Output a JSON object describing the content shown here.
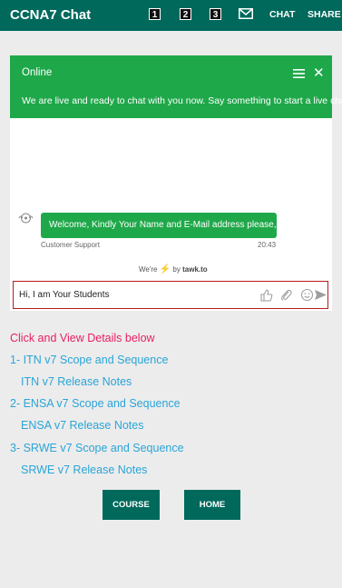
{
  "topbar": {
    "title": "CCNA7 Chat",
    "nums": [
      "1",
      "2",
      "3"
    ],
    "chat_label": "CHAT",
    "share_label": "SHARE"
  },
  "chat": {
    "status": "Online",
    "intro": "We are live and ready to chat with you now. Say something to start a live chat.",
    "message": "Welcome, Kindly Your Name and E-Mail address please,,,",
    "sender": "Customer Support",
    "time": "20:43",
    "powered_prefix": "We're",
    "powered_by": "by",
    "powered_brand": "tawk.to",
    "input_value": "Hi, I am Your Students"
  },
  "details": {
    "heading": "Click and View Details below",
    "links": [
      "1- ITN v7 Scope and Sequence",
      "ITN v7 Release Notes",
      "2- ENSA v7 Scope and Sequence",
      "ENSA v7 Release Notes",
      "3- SRWE v7 Scope and Sequence",
      "SRWE v7 Release Notes"
    ]
  },
  "buttons": {
    "course": "COURSE",
    "home": "HOME"
  },
  "colors": {
    "primary": "#00695c",
    "chat_green": "#1fa84a",
    "heading_pink": "#e91e63",
    "link_blue": "#29a5d8"
  }
}
